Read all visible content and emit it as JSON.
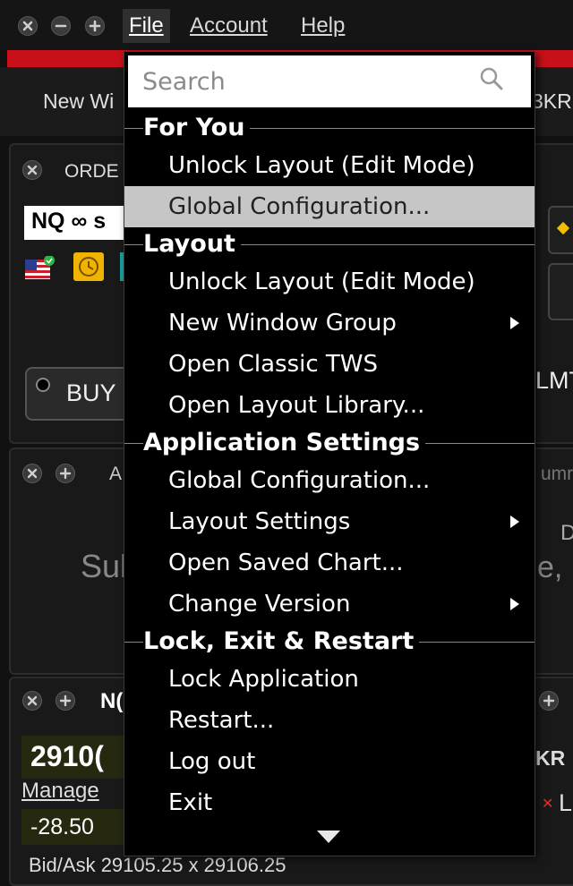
{
  "menubar": {
    "file": "File",
    "account": "Account",
    "help": "Help"
  },
  "tabs": {
    "new_window": "New Wi",
    "right_fragment": "3KR"
  },
  "background": {
    "order_panel_title": "ORDE",
    "symbol": "NQ ∞ s",
    "buy": "BUY",
    "lmt": "LMT",
    "panel2_a": "A",
    "panel2_sub": "Sul",
    "panel2_right_top": "umr",
    "panel2_d": "D",
    "panel2_e": "e,",
    "panel3_title": "N(",
    "price": "2910(",
    "manage": "Manage",
    "change": "-28.50",
    "bidask": "Bid/Ask 29105.25 x 29106.25",
    "kr": "KR",
    "lx": "L"
  },
  "dropdown": {
    "search_placeholder": "Search",
    "sections": [
      {
        "title": "For You",
        "items": [
          {
            "label": "Unlock Layout (Edit Mode)",
            "submenu": false,
            "highlighted": false
          },
          {
            "label": "Global Configuration...",
            "submenu": false,
            "highlighted": true
          }
        ]
      },
      {
        "title": "Layout",
        "items": [
          {
            "label": "Unlock Layout (Edit Mode)",
            "submenu": false,
            "highlighted": false
          },
          {
            "label": "New Window Group",
            "submenu": true,
            "highlighted": false
          },
          {
            "label": "Open Classic TWS",
            "submenu": false,
            "highlighted": false
          },
          {
            "label": "Open Layout Library...",
            "submenu": false,
            "highlighted": false
          }
        ]
      },
      {
        "title": "Application Settings",
        "items": [
          {
            "label": "Global Configuration...",
            "submenu": false,
            "highlighted": false
          },
          {
            "label": "Layout Settings",
            "submenu": true,
            "highlighted": false
          },
          {
            "label": "Open Saved Chart...",
            "submenu": false,
            "highlighted": false
          },
          {
            "label": "Change Version",
            "submenu": true,
            "highlighted": false
          }
        ]
      },
      {
        "title": "Lock, Exit & Restart",
        "items": [
          {
            "label": "Lock Application",
            "submenu": false,
            "highlighted": false
          },
          {
            "label": "Restart...",
            "submenu": false,
            "highlighted": false
          },
          {
            "label": "Log out",
            "submenu": false,
            "highlighted": false
          },
          {
            "label": "Exit",
            "submenu": false,
            "highlighted": false
          }
        ]
      }
    ]
  },
  "colors": {
    "brand_red": "#c8101a",
    "highlight": "#c6c6c6",
    "price_bg": "#26290f",
    "clock_icon": "#f0b400"
  }
}
